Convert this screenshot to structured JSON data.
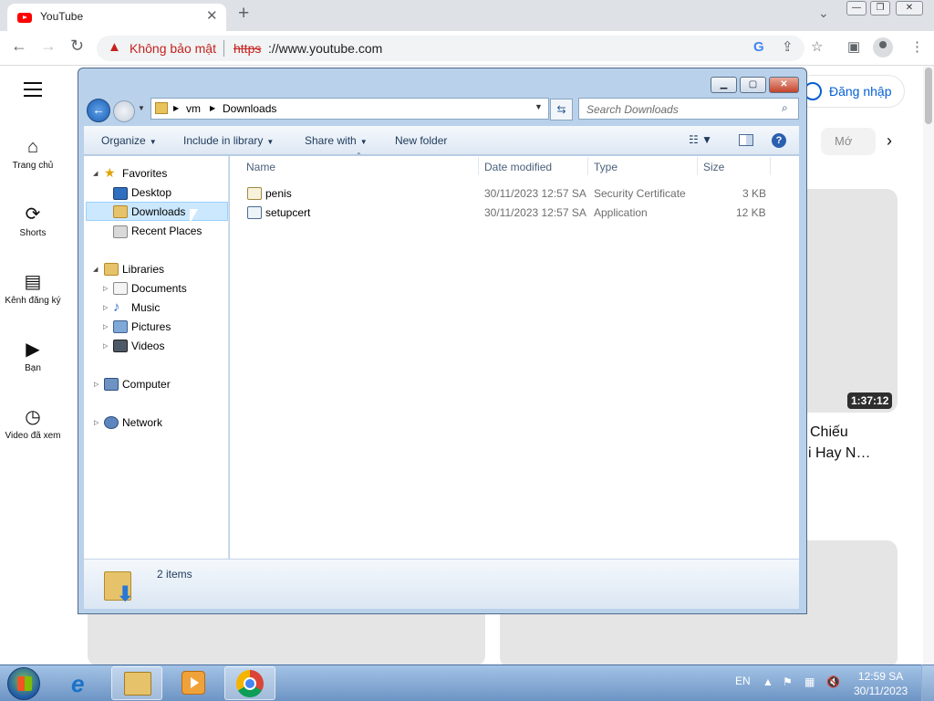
{
  "browser": {
    "tab_title": "YouTube",
    "tab_close": "✕",
    "new_tab": "+",
    "security_label": "Không bảo mật",
    "url_scheme": "https",
    "url_rest": "://www.youtube.com"
  },
  "youtube": {
    "nav": [
      {
        "icon": "home-icon",
        "label": "Trang chủ"
      },
      {
        "icon": "shorts-icon",
        "label": "Shorts"
      },
      {
        "icon": "subscriptions-icon",
        "label": "Kênh đăng ký"
      },
      {
        "icon": "library-icon",
        "label": "Bạn"
      },
      {
        "icon": "history-icon",
        "label": "Video đã xem"
      }
    ],
    "signin_label": "Đăng nhập",
    "chip_more": "Mớ",
    "video_duration": "1:37:12",
    "video_title_line1": "Chiếu",
    "video_title_line2": "i Hay N…"
  },
  "explorer": {
    "breadcrumb": [
      "vm",
      "Downloads"
    ],
    "search_placeholder": "Search Downloads",
    "commands": {
      "organize": "Organize",
      "include": "Include in library",
      "share": "Share with",
      "new_folder": "New folder"
    },
    "tree": {
      "favorites": "Favorites",
      "desktop": "Desktop",
      "downloads": "Downloads",
      "recent": "Recent Places",
      "libraries": "Libraries",
      "documents": "Documents",
      "music": "Music",
      "pictures": "Pictures",
      "videos": "Videos",
      "computer": "Computer",
      "network": "Network"
    },
    "columns": {
      "name": "Name",
      "date": "Date modified",
      "type": "Type",
      "size": "Size"
    },
    "files": [
      {
        "name": "penis",
        "date": "30/11/2023 12:57 SA",
        "type": "Security Certificate",
        "size": "3 KB"
      },
      {
        "name": "setupcert",
        "date": "30/11/2023 12:57 SA",
        "type": "Application",
        "size": "12 KB"
      }
    ],
    "status": "2 items"
  },
  "taskbar": {
    "lang": "EN",
    "time": "12:59 SA",
    "date": "30/11/2023"
  }
}
